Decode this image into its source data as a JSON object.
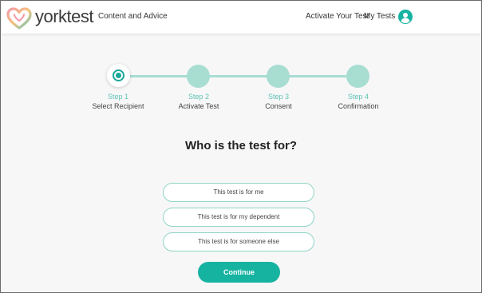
{
  "header": {
    "brand": "yorktest",
    "nav_left": "Content and Advice",
    "nav_activate": "Activate Your Test",
    "nav_my_tests": "My Tests",
    "avatar_icon": "user-circle-icon"
  },
  "stepper": {
    "steps": [
      {
        "num": "Step 1",
        "label": "Select Recipient",
        "state": "active"
      },
      {
        "num": "Step 2",
        "label": "Activate Test",
        "state": "inactive"
      },
      {
        "num": "Step 3",
        "label": "Consent",
        "state": "inactive"
      },
      {
        "num": "Step 4",
        "label": "Confirmation",
        "state": "inactive"
      }
    ]
  },
  "main": {
    "question": "Who is the test for?",
    "options": [
      "This test is for me",
      "This test is for my dependent",
      "This test is for someone else"
    ],
    "continue_label": "Continue"
  },
  "colors": {
    "accent": "#16b3a1",
    "step_inactive": "#a8ddd2",
    "step_text": "#5fc2b3",
    "option_border": "#8fd4c6"
  }
}
